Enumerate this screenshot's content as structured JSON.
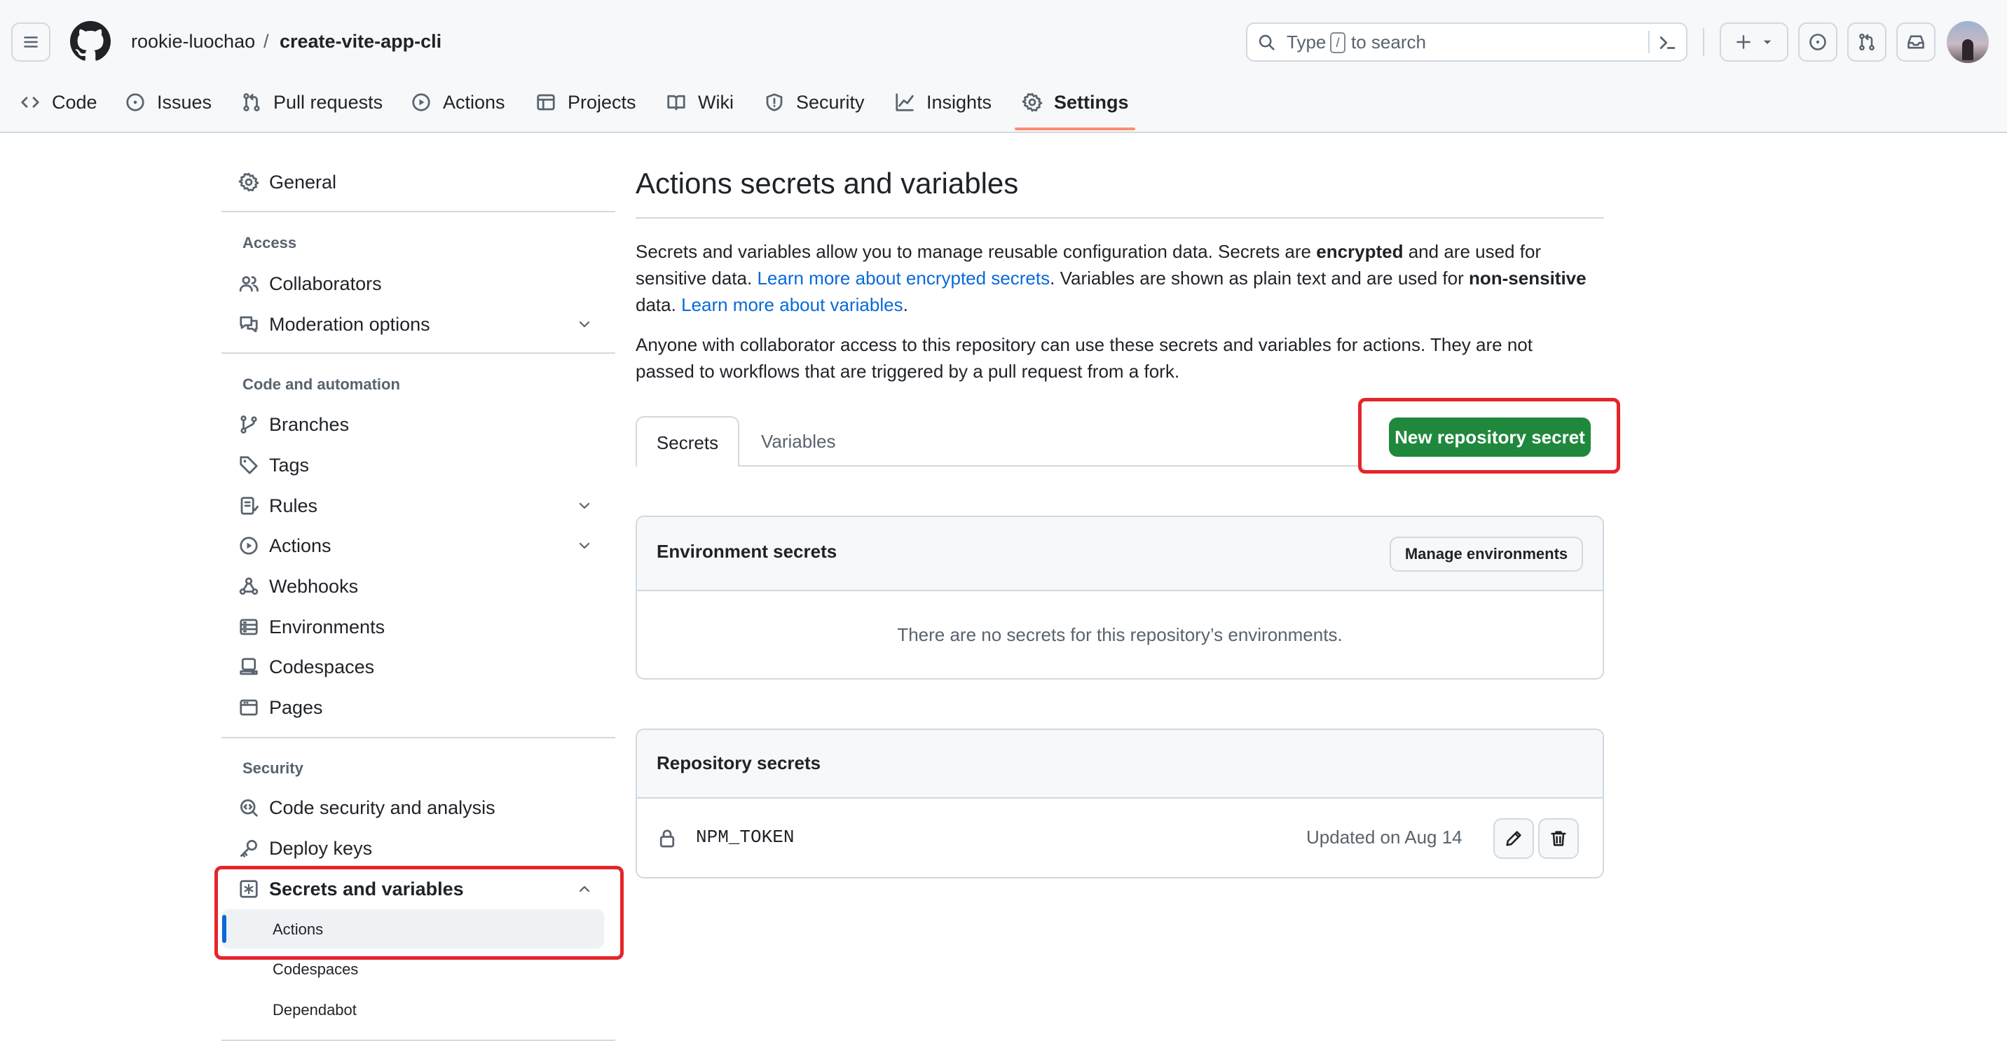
{
  "header": {
    "owner": "rookie-luochao",
    "separator": "/",
    "repo": "create-vite-app-cli",
    "search_prefix": "Type",
    "search_key": "/",
    "search_suffix": "to search"
  },
  "tabs": [
    {
      "label": "Code",
      "icon": "code-icon"
    },
    {
      "label": "Issues",
      "icon": "issue-icon"
    },
    {
      "label": "Pull requests",
      "icon": "pull-request-icon"
    },
    {
      "label": "Actions",
      "icon": "play-icon"
    },
    {
      "label": "Projects",
      "icon": "table-icon"
    },
    {
      "label": "Wiki",
      "icon": "book-icon"
    },
    {
      "label": "Security",
      "icon": "shield-icon"
    },
    {
      "label": "Insights",
      "icon": "graph-icon"
    },
    {
      "label": "Settings",
      "icon": "gear-icon",
      "selected": true
    }
  ],
  "sidebar": {
    "general": "General",
    "access_heading": "Access",
    "collaborators": "Collaborators",
    "moderation": "Moderation options",
    "code_heading": "Code and automation",
    "branches": "Branches",
    "tags": "Tags",
    "rules": "Rules",
    "actions": "Actions",
    "webhooks": "Webhooks",
    "environments": "Environments",
    "codespaces": "Codespaces",
    "pages": "Pages",
    "security_heading": "Security",
    "code_security": "Code security and analysis",
    "deploy_keys": "Deploy keys",
    "secrets_vars": "Secrets and variables",
    "sub_actions": "Actions",
    "sub_codespaces": "Codespaces",
    "sub_dependabot": "Dependabot"
  },
  "main": {
    "title": "Actions secrets and variables",
    "p1_a": "Secrets and variables allow you to manage reusable configuration data. Secrets are ",
    "p1_b": "encrypted",
    "p1_c": " and are used for sensitive data. ",
    "p1_link1": "Learn more about encrypted secrets",
    "p1_d": ". Variables are shown as plain text and are used for ",
    "p1_e": "non-sensitive",
    "p1_f": " data. ",
    "p1_link2": "Learn more about variables",
    "p1_g": ".",
    "p2": "Anyone with collaborator access to this repository can use these secrets and variables for actions. They are not passed to workflows that are triggered by a pull request from a fork.",
    "tab_secrets": "Secrets",
    "tab_variables": "Variables",
    "new_secret_button": "New repository secret",
    "env_title": "Environment secrets",
    "manage_env_button": "Manage environments",
    "env_empty": "There are no secrets for this repository’s environments.",
    "repo_title": "Repository secrets",
    "secret_name": "NPM_TOKEN",
    "secret_updated": "Updated on Aug 14"
  },
  "colors": {
    "primary_green": "#1f883d",
    "link_blue": "#0969da",
    "tab_underline": "#fd8c73",
    "highlight_red": "#e5252a"
  }
}
